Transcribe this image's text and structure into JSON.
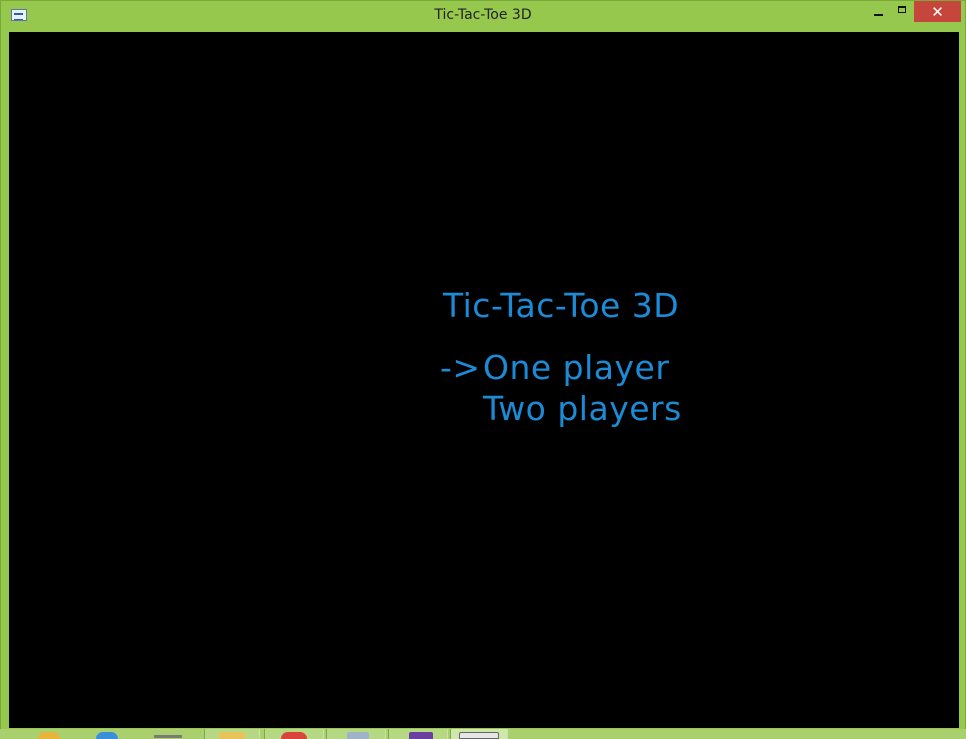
{
  "window": {
    "title": "Tic-Tac-Toe 3D",
    "close_glyph": "✕"
  },
  "game": {
    "title": "Tic-Tac-Toe 3D",
    "cursor": "->",
    "options": [
      {
        "label": "One player",
        "selected": true
      },
      {
        "label": "Two players",
        "selected": false
      }
    ]
  },
  "colors": {
    "frame": "#95c84d",
    "menu_text": "#1c8bd6",
    "background": "#000000",
    "close_button": "#c7463c"
  },
  "taskbar": {
    "icons": [
      "windows-flag-icon",
      "internet-explorer-icon",
      "file-explorer-icon",
      "folder-icon",
      "chrome-icon",
      "document-icon",
      "visual-studio-icon",
      "game-window-icon"
    ]
  }
}
